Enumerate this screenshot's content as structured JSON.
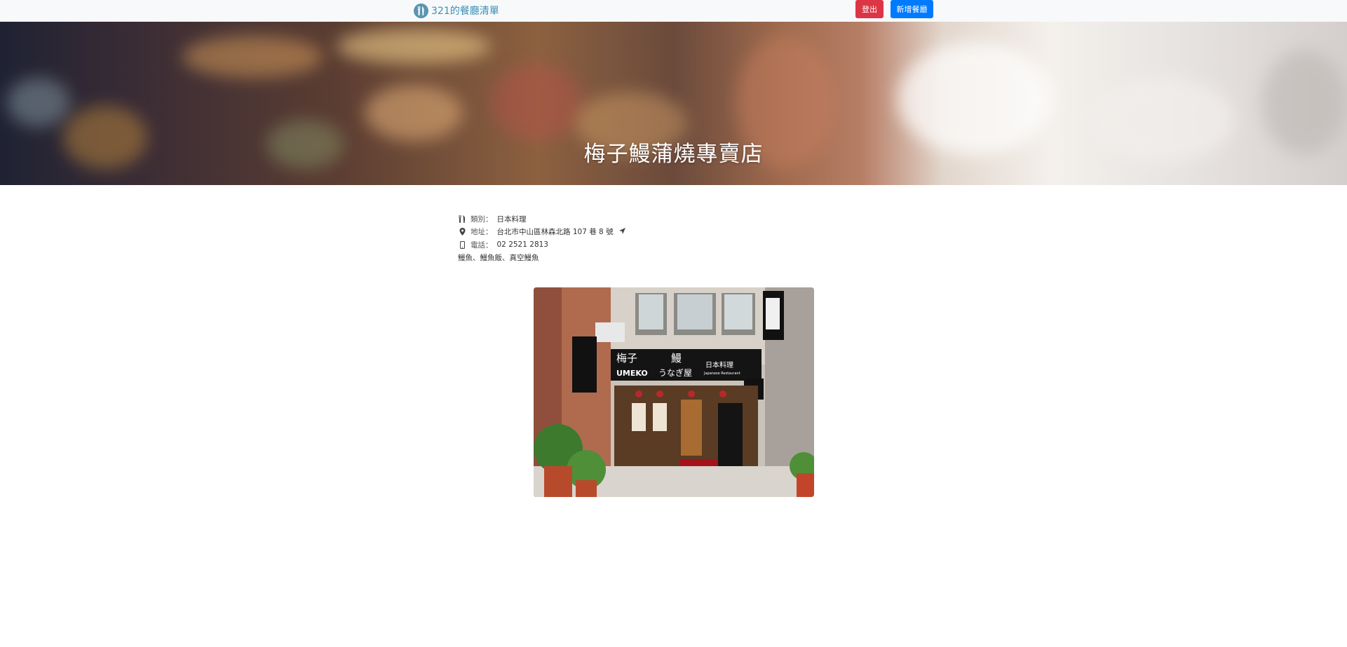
{
  "navbar": {
    "brand_text": "321的餐廳清單",
    "logout_label": "登出",
    "add_label": "新增餐廳"
  },
  "banner": {
    "title": "梅子鰻蒲燒專賣店"
  },
  "info": {
    "category_label": "類別：",
    "category_value": "日本料理",
    "address_label": "地址：",
    "address_value": "台北市中山區林森北路 107 巷 8 號",
    "phone_label": "電話：",
    "phone_value": "02 2521 2813",
    "description": "鰻魚、鰻魚飯、真空鰻魚"
  },
  "photo": {
    "sign_main": "梅子",
    "sign_eel": "鰻",
    "sign_roman": "UMEKO",
    "sign_kana": "うなぎ屋",
    "sign_jp": "日本料理",
    "sign_en": "Japanese Restaurant"
  },
  "colors": {
    "brand": "#3b8fb7",
    "logout": "#dc3545",
    "add": "#007bff"
  },
  "icons": {
    "brand": "utensils-icon",
    "category": "utensils-icon",
    "address": "map-marker-icon",
    "phone": "mobile-phone-icon",
    "directions": "location-arrow-icon"
  }
}
